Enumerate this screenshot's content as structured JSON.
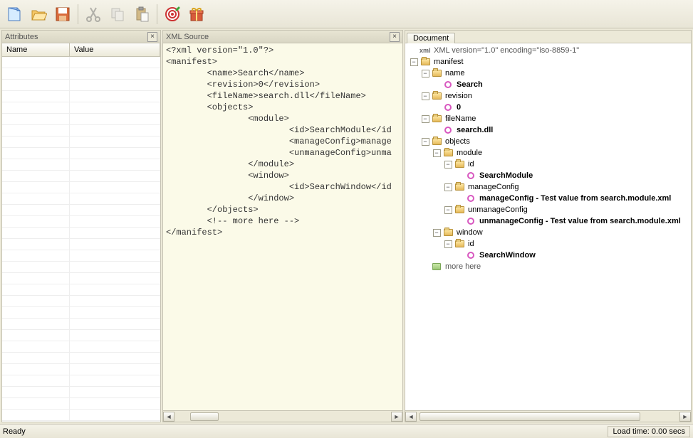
{
  "toolbar": {
    "icons": [
      "new-doc",
      "open",
      "save",
      "cut",
      "copy",
      "paste",
      "target",
      "gift"
    ]
  },
  "panels": {
    "attributes": {
      "title": "Attributes",
      "col_name": "Name",
      "col_value": "Value"
    },
    "xml": {
      "title": "XML Source",
      "content": "<?xml version=\"1.0\"?>\n<manifest>\n        <name>Search</name>\n        <revision>0</revision>\n        <fileName>search.dll</fileName>\n        <objects>\n                <module>\n                        <id>SearchModule</id\n                        <manageConfig>manage\n                        <unmanageConfig>unma\n                </module>\n                <window>\n                        <id>SearchWindow</id\n                </window>\n        </objects>\n        <!-- more here -->\n</manifest>"
    },
    "document": {
      "tab": "Document",
      "decl": "XML version=\"1.0\" encoding=\"iso-8859-1\"",
      "n_manifest": "manifest",
      "n_name": "name",
      "v_name": "Search",
      "n_revision": "revision",
      "v_revision": "0",
      "n_fileName": "fileName",
      "v_fileName": "search.dll",
      "n_objects": "objects",
      "n_module": "module",
      "n_id": "id",
      "v_moduleId": "SearchModule",
      "n_manageConfig": "manageConfig",
      "v_manageConfig": "manageConfig - Test value from search.module.xml",
      "n_unmanageConfig": "unmanageConfig",
      "v_unmanageConfig": "unmanageConfig - Test value from search.module.xml",
      "n_window": "window",
      "v_windowId": "SearchWindow",
      "n_comment": "more here"
    }
  },
  "status": {
    "ready": "Ready",
    "loadtime": "Load time: 0.00 secs"
  }
}
